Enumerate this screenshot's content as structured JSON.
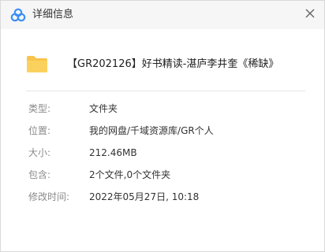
{
  "window": {
    "title": "详细信息"
  },
  "file": {
    "name": "【GR202126】好书精读-湛庐李井奎《稀缺》",
    "icon": "folder-icon"
  },
  "details": [
    {
      "label": "类型:",
      "value": "文件夹"
    },
    {
      "label": "位置:",
      "value": "我的网盘/千域资源库/GR个人"
    },
    {
      "label": "大小:",
      "value": "212.46MB"
    },
    {
      "label": "包含:",
      "value": "2个文件,0个文件夹"
    },
    {
      "label": "修改时间:",
      "value": "2022年05月27日, 10:18"
    }
  ],
  "colors": {
    "brand": "#3a8ff7",
    "folder": "#f8c44c",
    "folder_tab": "#f0b73a"
  }
}
